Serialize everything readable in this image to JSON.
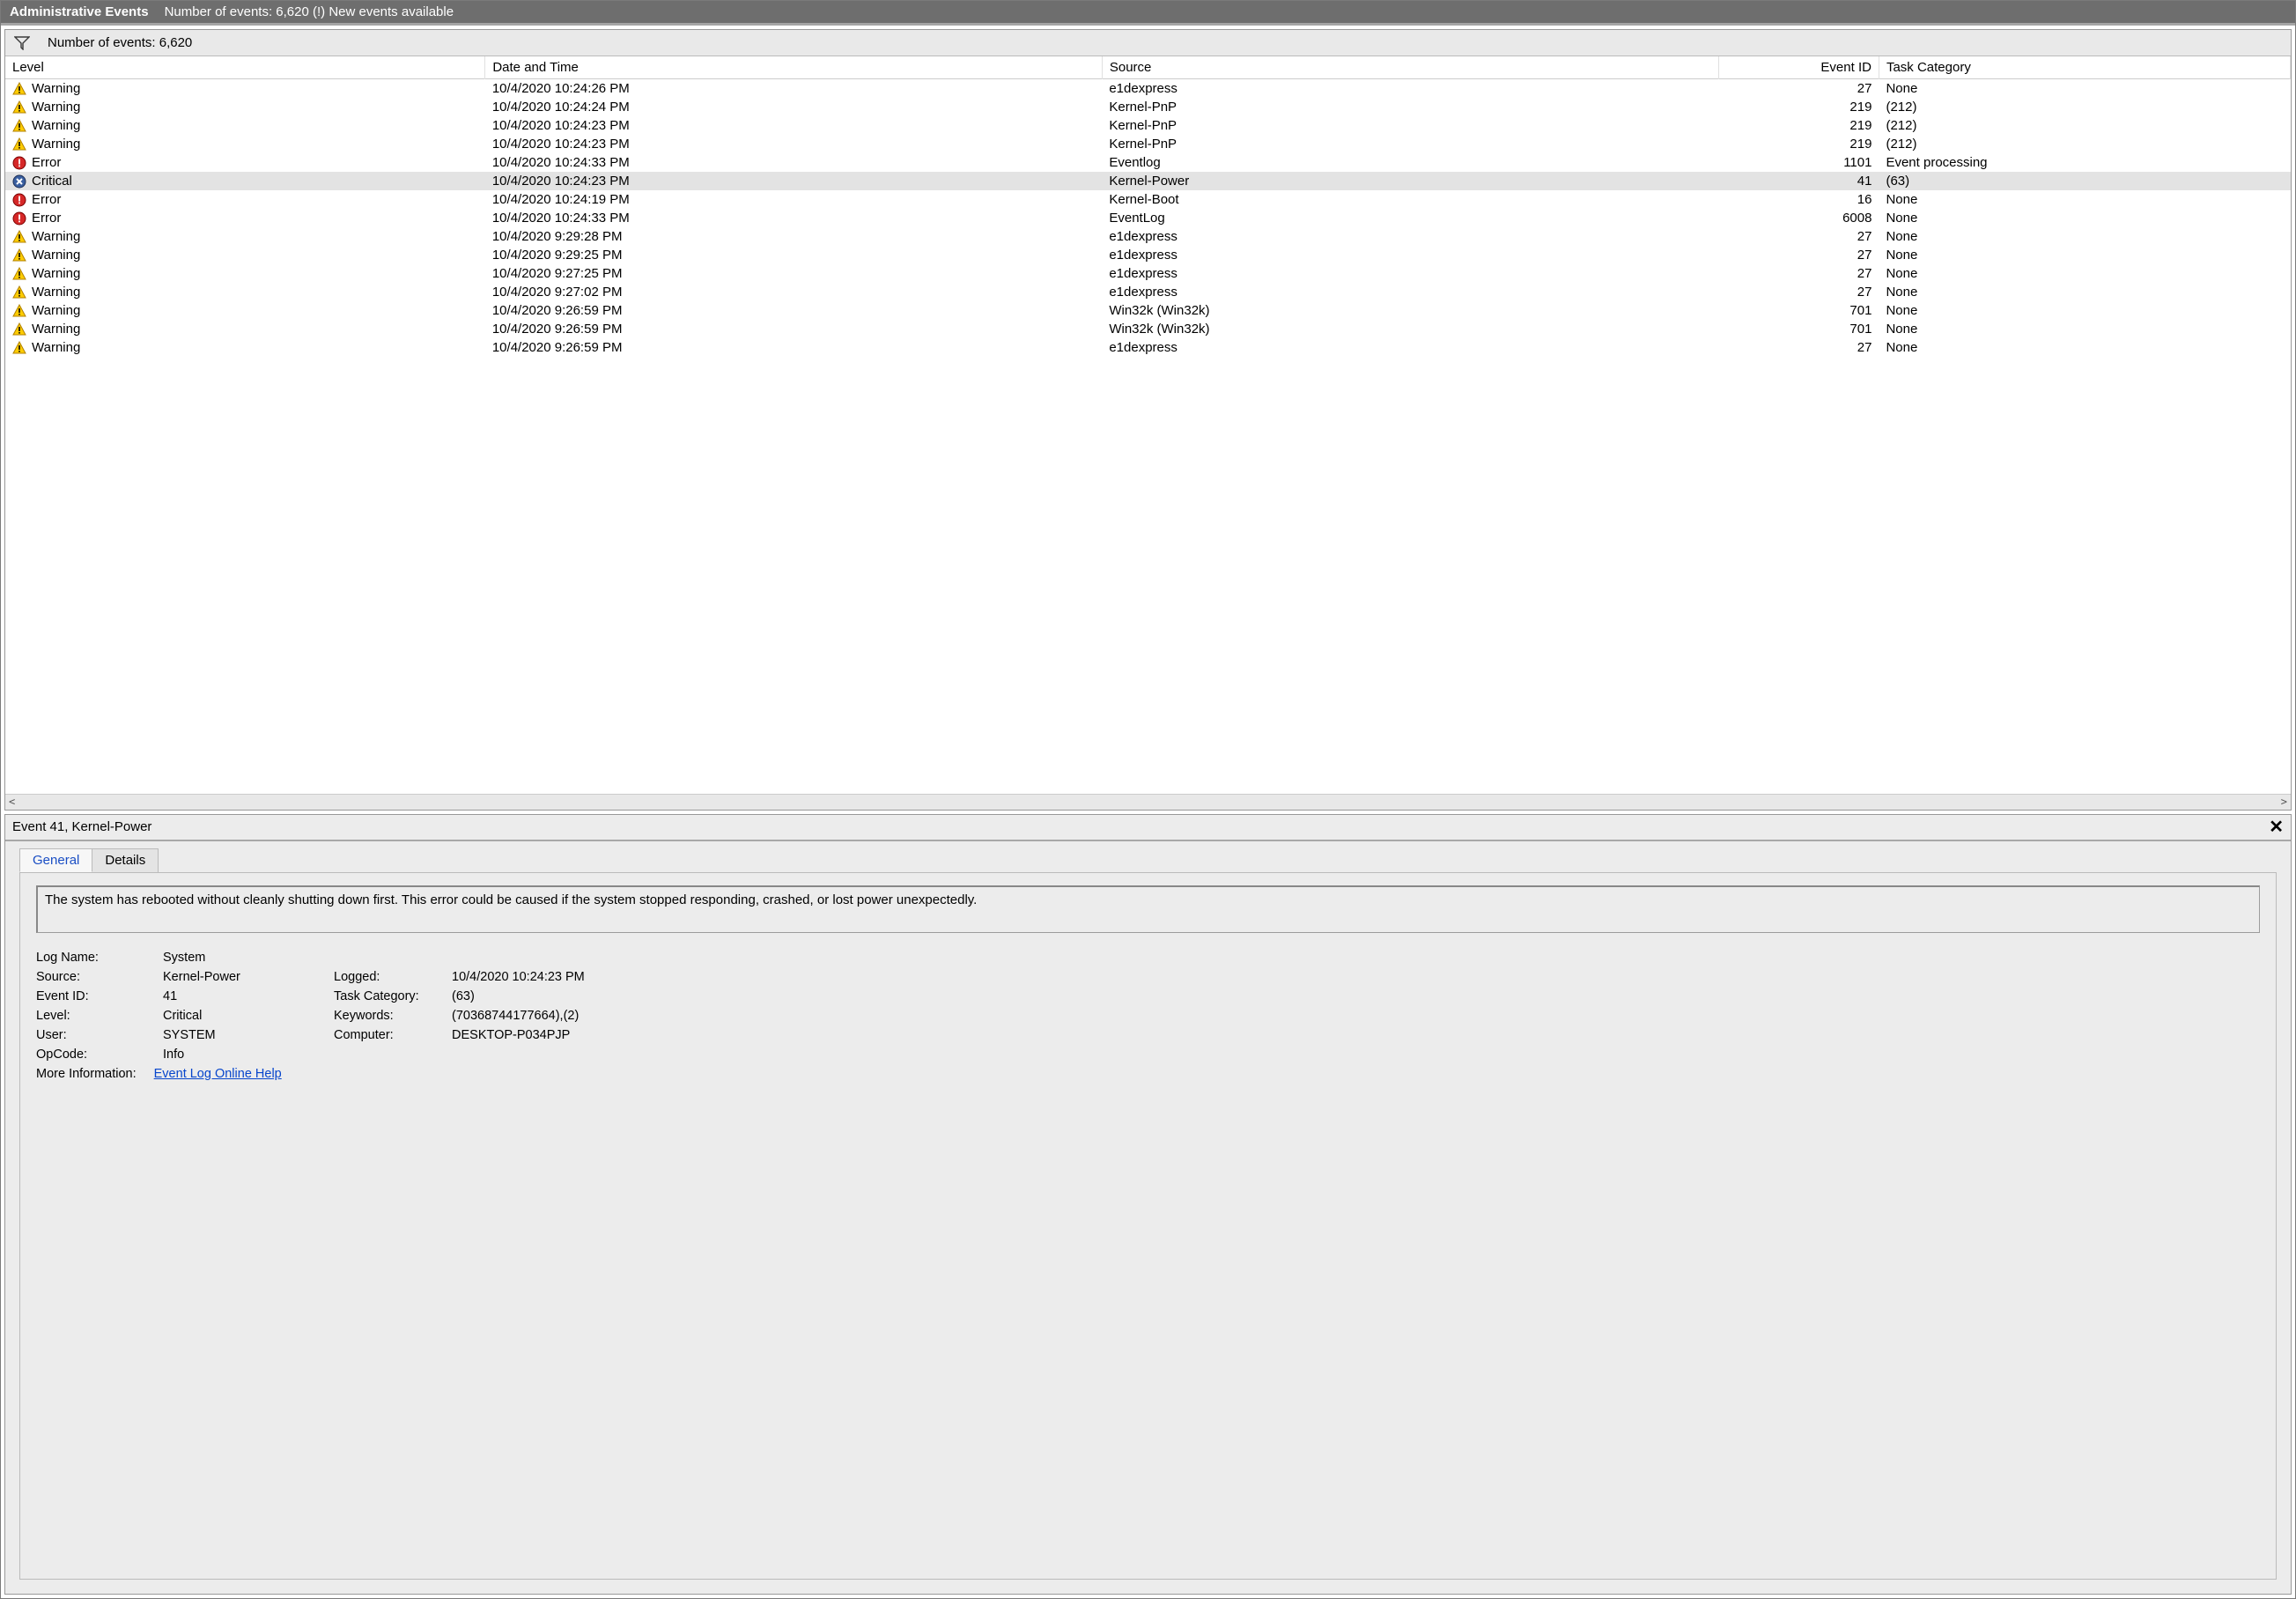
{
  "titlebar": {
    "title": "Administrative Events",
    "subtitle": "Number of events: 6,620 (!) New events available"
  },
  "filterbar": {
    "count_label": "Number of events: 6,620"
  },
  "columns": {
    "level": "Level",
    "date": "Date and Time",
    "source": "Source",
    "event_id": "Event ID",
    "task_category": "Task Category"
  },
  "rows": [
    {
      "level": "Warning",
      "date": "10/4/2020 10:24:26 PM",
      "source": "e1dexpress",
      "event_id": "27",
      "cat": "None",
      "icon": "warning"
    },
    {
      "level": "Warning",
      "date": "10/4/2020 10:24:24 PM",
      "source": "Kernel-PnP",
      "event_id": "219",
      "cat": "(212)",
      "icon": "warning"
    },
    {
      "level": "Warning",
      "date": "10/4/2020 10:24:23 PM",
      "source": "Kernel-PnP",
      "event_id": "219",
      "cat": "(212)",
      "icon": "warning"
    },
    {
      "level": "Warning",
      "date": "10/4/2020 10:24:23 PM",
      "source": "Kernel-PnP",
      "event_id": "219",
      "cat": "(212)",
      "icon": "warning"
    },
    {
      "level": "Error",
      "date": "10/4/2020 10:24:33 PM",
      "source": "Eventlog",
      "event_id": "1101",
      "cat": "Event processing",
      "icon": "error"
    },
    {
      "level": "Critical",
      "date": "10/4/2020 10:24:23 PM",
      "source": "Kernel-Power",
      "event_id": "41",
      "cat": "(63)",
      "icon": "critical",
      "selected": true
    },
    {
      "level": "Error",
      "date": "10/4/2020 10:24:19 PM",
      "source": "Kernel-Boot",
      "event_id": "16",
      "cat": "None",
      "icon": "error"
    },
    {
      "level": "Error",
      "date": "10/4/2020 10:24:33 PM",
      "source": "EventLog",
      "event_id": "6008",
      "cat": "None",
      "icon": "error"
    },
    {
      "level": "Warning",
      "date": "10/4/2020 9:29:28 PM",
      "source": "e1dexpress",
      "event_id": "27",
      "cat": "None",
      "icon": "warning"
    },
    {
      "level": "Warning",
      "date": "10/4/2020 9:29:25 PM",
      "source": "e1dexpress",
      "event_id": "27",
      "cat": "None",
      "icon": "warning"
    },
    {
      "level": "Warning",
      "date": "10/4/2020 9:27:25 PM",
      "source": "e1dexpress",
      "event_id": "27",
      "cat": "None",
      "icon": "warning"
    },
    {
      "level": "Warning",
      "date": "10/4/2020 9:27:02 PM",
      "source": "e1dexpress",
      "event_id": "27",
      "cat": "None",
      "icon": "warning"
    },
    {
      "level": "Warning",
      "date": "10/4/2020 9:26:59 PM",
      "source": "Win32k (Win32k)",
      "event_id": "701",
      "cat": "None",
      "icon": "warning"
    },
    {
      "level": "Warning",
      "date": "10/4/2020 9:26:59 PM",
      "source": "Win32k (Win32k)",
      "event_id": "701",
      "cat": "None",
      "icon": "warning"
    },
    {
      "level": "Warning",
      "date": "10/4/2020 9:26:59 PM",
      "source": "e1dexpress",
      "event_id": "27",
      "cat": "None",
      "icon": "warning"
    }
  ],
  "detail": {
    "header": "Event 41, Kernel-Power",
    "tabs": {
      "general": "General",
      "details": "Details"
    },
    "description": "The system has rebooted without cleanly shutting down first. This error could be caused if the system stopped responding, crashed, or lost power unexpectedly.",
    "fields": {
      "log_name_k": "Log Name:",
      "log_name_v": "System",
      "source_k": "Source:",
      "source_v": "Kernel-Power",
      "logged_k": "Logged:",
      "logged_v": "10/4/2020 10:24:23 PM",
      "event_id_k": "Event ID:",
      "event_id_v": "41",
      "task_cat_k": "Task Category:",
      "task_cat_v": "(63)",
      "level_k": "Level:",
      "level_v": "Critical",
      "keywords_k": "Keywords:",
      "keywords_v": "(70368744177664),(2)",
      "user_k": "User:",
      "user_v": "SYSTEM",
      "computer_k": "Computer:",
      "computer_v": "DESKTOP-P034PJP",
      "opcode_k": "OpCode:",
      "opcode_v": "Info",
      "moreinfo_k": "More Information:",
      "moreinfo_link": "Event Log Online Help"
    }
  }
}
